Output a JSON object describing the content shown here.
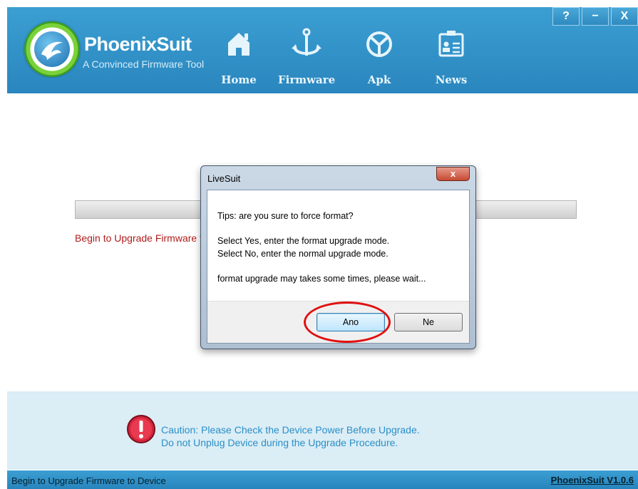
{
  "app": {
    "name": "PhoenixSuit",
    "tagline": "A Convinced Firmware Tool"
  },
  "window_buttons": {
    "help": "?",
    "minimize": "−",
    "close": "X"
  },
  "nav": [
    {
      "label": "Home",
      "icon": "home-icon"
    },
    {
      "label": "Firmware",
      "icon": "anchor-icon"
    },
    {
      "label": "Apk",
      "icon": "android-icon"
    },
    {
      "label": "News",
      "icon": "news-icon"
    }
  ],
  "main": {
    "status_text": "Begin to Upgrade Firmware to Device",
    "progress": 0
  },
  "dialog": {
    "title": "LiveSuit",
    "close": "x",
    "lines": [
      "Tips: are you sure to force format?",
      "Select Yes, enter the format upgrade mode.",
      "Select No, enter the normal upgrade mode.",
      "format upgrade may takes some times, please wait..."
    ],
    "yes_label": "Ano",
    "no_label": "Ne"
  },
  "caution": {
    "line1": "Caution: Please Check the Device Power Before Upgrade.",
    "line2": "Do not Unplug Device during the Upgrade Procedure."
  },
  "statusbar": {
    "left": "Begin to Upgrade Firmware to Device",
    "right": "PhoenixSuit V1.0.6"
  },
  "colors": {
    "header": "#2f92c9",
    "caution_text": "#2a8fc9",
    "status_red": "#b01c1c",
    "highlight": "#e01010"
  }
}
